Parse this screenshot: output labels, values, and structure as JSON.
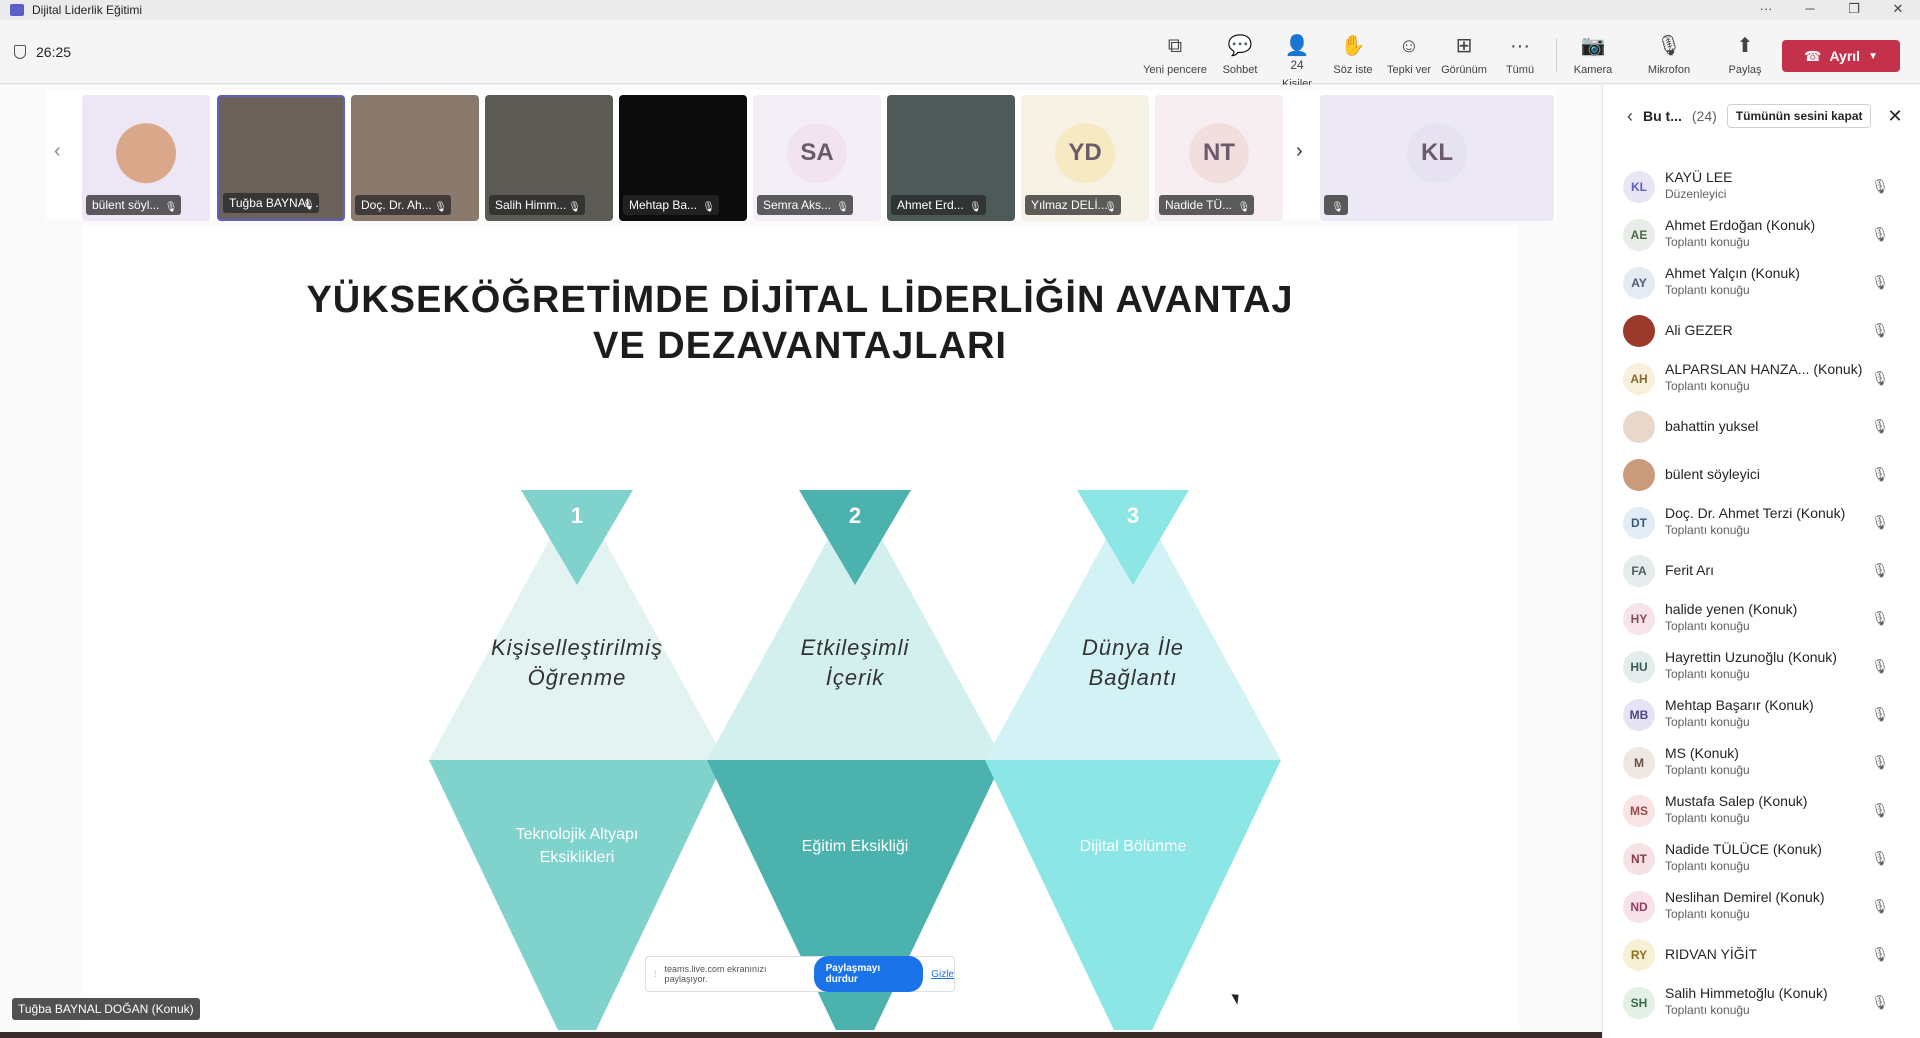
{
  "window": {
    "title": "Dijital Liderlik Eğitimi",
    "controls": [
      "···",
      "─",
      "❐",
      "✕"
    ]
  },
  "toolbar": {
    "timer": "26:25",
    "people_count": "24",
    "buttons": [
      {
        "label": "Yeni pencere",
        "icon": "⧉"
      },
      {
        "label": "Sohbet",
        "icon": "💬"
      },
      {
        "label": "Kişiler",
        "icon": "👤"
      },
      {
        "label": "Söz iste",
        "icon": "✋"
      },
      {
        "label": "Tepki ver",
        "icon": "☺"
      },
      {
        "label": "Görünüm",
        "icon": "⊞"
      },
      {
        "label": "Tümü",
        "icon": "···"
      },
      {
        "label": "Kamera",
        "icon": "📷"
      },
      {
        "label": "Mikrofon",
        "icon": "🎙"
      },
      {
        "label": "Paylaş",
        "icon": "⬆"
      }
    ],
    "leave_label": "Ayrıl"
  },
  "strip": {
    "tiles": [
      {
        "name": "bülent söyl...",
        "initials": "",
        "bg": "#ede6f5",
        "avatar_color": "#d9a88a"
      },
      {
        "name": "Tuğba BAYNAL ...",
        "initials": "",
        "bg": "#6a6258",
        "avatar_color": ""
      },
      {
        "name": "Doç. Dr. Ah...",
        "initials": "",
        "bg": "#8a7a6e",
        "avatar_color": ""
      },
      {
        "name": "Salih Himm...",
        "initials": "",
        "bg": "#5c5a55",
        "avatar_color": ""
      },
      {
        "name": "Mehtap Ba...",
        "initials": "",
        "bg": "#0c0c0c",
        "avatar_color": ""
      },
      {
        "name": "Semra Aks...",
        "initials": "SA",
        "bg": "#f4eef7",
        "avatar_color": "#f1e4f0"
      },
      {
        "name": "Ahmet Erd...",
        "initials": "",
        "bg": "#4e5a58",
        "avatar_color": ""
      },
      {
        "name": "Yılmaz DELİ...",
        "initials": "YD",
        "bg": "#f6f3e6",
        "avatar_color": "#f7eac2"
      },
      {
        "name": "Nadide TÜ...",
        "initials": "NT",
        "bg": "#f6eef0",
        "avatar_color": "#f3dede"
      },
      {
        "name": "",
        "initials": "KL",
        "bg": "#ece9f5",
        "avatar_color": "#e6e2f2"
      }
    ]
  },
  "slide": {
    "title_line1": "YÜKSEKÖĞRETİMDE DİJİTAL LİDERLİĞİN AVANTAJ",
    "title_line2": "VE DEZAVANTAJLARI",
    "items": [
      {
        "num": "1",
        "top": "Kişiselleştirilmiş\nÖğrenme",
        "bottom": "Teknolojik Altyapı\nEksiklikleri",
        "top_color": "#e2f3f1",
        "bottom_color": "#7fd3cc",
        "num_color": "#7fd3cc"
      },
      {
        "num": "2",
        "top": "Etkileşimli\nİçerik",
        "bottom": "Eğitim Eksikliği",
        "top_color": "#d3efee",
        "bottom_color": "#4bb2ad",
        "num_color": "#4bb2ad"
      },
      {
        "num": "3",
        "top": "Dünya İle\nBağlantı",
        "bottom": "Dijital Bölünme",
        "top_color": "#d2f2f6",
        "bottom_color": "#8de6e6",
        "num_color": "#8de6e6"
      }
    ]
  },
  "share_bar": {
    "text": "teams.live.com ekranınızı paylaşıyor.",
    "stop": "Paylaşmayı durdur",
    "hide": "Gizle"
  },
  "speaker_tag": "Tuğba BAYNAL DOĞAN (Konuk)",
  "panel": {
    "title": "Bu t...",
    "count": "(24)",
    "mute_all": "Tümünün sesini kapat",
    "people": [
      {
        "initials": "KL",
        "name": "KAYÜ LEE",
        "sub": "Düzenleyici",
        "bg": "#e8e6f5",
        "fg": "#5b5fc7"
      },
      {
        "initials": "AE",
        "name": "Ahmet Erdoğan (Konuk)",
        "sub": "Toplantı konuğu",
        "bg": "#e8ede8",
        "fg": "#4a6a4a"
      },
      {
        "initials": "AY",
        "name": "Ahmet Yalçın (Konuk)",
        "sub": "Toplantı konuğu",
        "bg": "#e4ebf2",
        "fg": "#4a5e78"
      },
      {
        "initials": "",
        "name": "Ali GEZER",
        "sub": "",
        "bg": "#9b3a2a",
        "fg": "#fff"
      },
      {
        "initials": "AH",
        "name": "ALPARSLAN HANZA... (Konuk)",
        "sub": "Toplantı konuğu",
        "bg": "#f8f0dc",
        "fg": "#8a6a2a"
      },
      {
        "initials": "",
        "name": "bahattin yuksel",
        "sub": "",
        "bg": "#e8d8cc",
        "fg": "#fff"
      },
      {
        "initials": "",
        "name": "bülent söyleyici",
        "sub": "",
        "bg": "#c99a7c",
        "fg": "#fff"
      },
      {
        "initials": "DT",
        "name": "Doç. Dr. Ahmet Terzi (Konuk)",
        "sub": "Toplantı konuğu",
        "bg": "#e2ecf6",
        "fg": "#3a5a7a"
      },
      {
        "initials": "FA",
        "name": "Ferit Arı",
        "sub": "",
        "bg": "#e6ecec",
        "fg": "#4a6060"
      },
      {
        "initials": "HY",
        "name": "halide yenen (Konuk)",
        "sub": "Toplantı konuğu",
        "bg": "#f6e4ea",
        "fg": "#8a4a5a"
      },
      {
        "initials": "HU",
        "name": "Hayrettin Uzunoğlu (Konuk)",
        "sub": "Toplantı konuğu",
        "bg": "#e4ecec",
        "fg": "#3a5a5a"
      },
      {
        "initials": "MB",
        "name": "Mehtap Başarır (Konuk)",
        "sub": "Toplantı konuğu",
        "bg": "#e6e4f4",
        "fg": "#4a4a8a"
      },
      {
        "initials": "M",
        "name": "MS (Konuk)",
        "sub": "Toplantı konuğu",
        "bg": "#efe8e2",
        "fg": "#6a5040"
      },
      {
        "initials": "MS",
        "name": "Mustafa Salep (Konuk)",
        "sub": "Toplantı konuğu",
        "bg": "#f8e4e4",
        "fg": "#9a4a4a"
      },
      {
        "initials": "NT",
        "name": "Nadide TÜLÜCE (Konuk)",
        "sub": "Toplantı konuğu",
        "bg": "#f4e2e4",
        "fg": "#8a3a4a"
      },
      {
        "initials": "ND",
        "name": "Neslihan Demirel (Konuk)",
        "sub": "Toplantı konuğu",
        "bg": "#f8e2ea",
        "fg": "#9a3a5a"
      },
      {
        "initials": "RY",
        "name": "RIDVAN YİĞİT",
        "sub": "",
        "bg": "#f8f0d4",
        "fg": "#8a7020"
      },
      {
        "initials": "SH",
        "name": "Salih Himmetoğlu (Konuk)",
        "sub": "Toplantı konuğu",
        "bg": "#e2f0e6",
        "fg": "#3a6a4a"
      }
    ]
  }
}
